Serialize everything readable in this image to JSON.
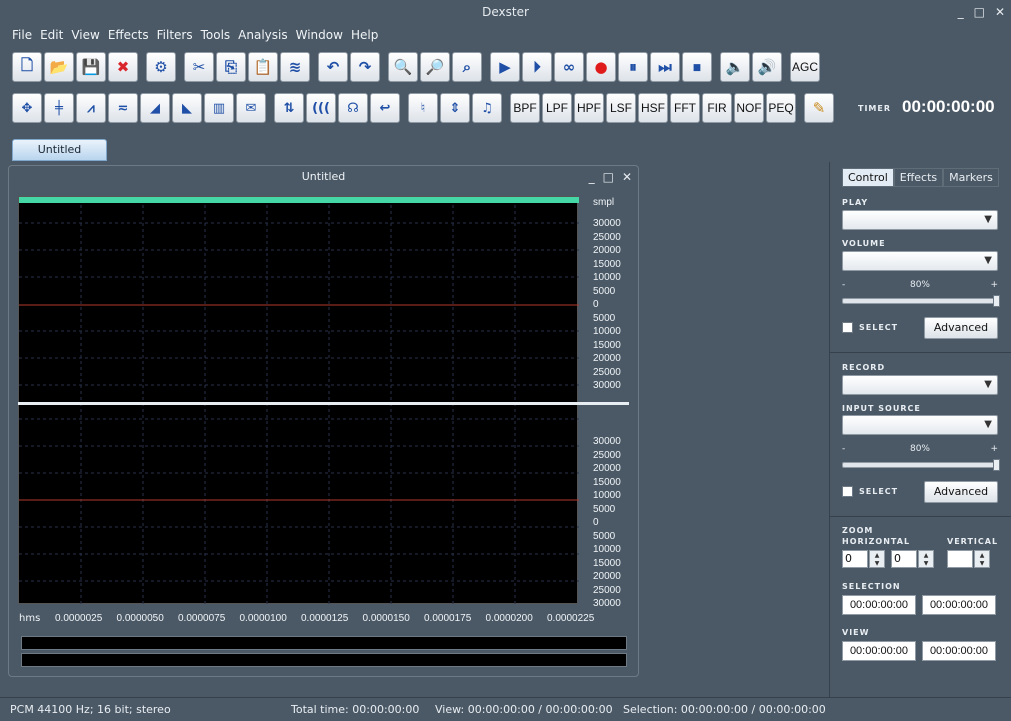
{
  "app": {
    "title": "Dexster"
  },
  "menu": [
    "File",
    "Edit",
    "View",
    "Effects",
    "Filters",
    "Tools",
    "Analysis",
    "Window",
    "Help"
  ],
  "toolbar1": [
    {
      "name": "new-icon",
      "glyph": "🗋"
    },
    {
      "name": "open-icon",
      "glyph": "📂"
    },
    {
      "name": "save-icon",
      "glyph": "💾"
    },
    {
      "name": "close-file-icon",
      "glyph": "✖"
    },
    {
      "name": "settings-icon",
      "glyph": "⚙"
    },
    {
      "name": "cut-icon",
      "glyph": "✂"
    },
    {
      "name": "copy-icon",
      "glyph": "⎘"
    },
    {
      "name": "paste-icon",
      "glyph": "📋"
    },
    {
      "name": "mix-paste-icon",
      "glyph": "≋"
    },
    {
      "name": "undo-icon",
      "glyph": "↶"
    },
    {
      "name": "redo-icon",
      "glyph": "↷"
    },
    {
      "name": "zoom-in-icon",
      "glyph": "🔍"
    },
    {
      "name": "zoom-out-icon",
      "glyph": "🔎"
    },
    {
      "name": "zoom-fit-icon",
      "glyph": "⌕"
    },
    {
      "name": "play-icon",
      "glyph": "▶"
    },
    {
      "name": "play-circle-icon",
      "glyph": "⏵"
    },
    {
      "name": "loop-icon",
      "glyph": "∞"
    },
    {
      "name": "record-icon",
      "glyph": "●"
    },
    {
      "name": "pause-icon",
      "glyph": "⏸"
    },
    {
      "name": "forward-icon",
      "glyph": "⏭"
    },
    {
      "name": "stop-icon",
      "glyph": "⏹"
    },
    {
      "name": "speaker-left-icon",
      "glyph": "🔈"
    },
    {
      "name": "speaker-right-icon",
      "glyph": "🔊"
    }
  ],
  "toolbar1_agc": "AGC",
  "toolbar2": [
    {
      "name": "expand-icon",
      "glyph": "✥"
    },
    {
      "name": "compress-icon",
      "glyph": "╪"
    },
    {
      "name": "noise-icon",
      "glyph": "⩘"
    },
    {
      "name": "silence-icon",
      "glyph": "≂"
    },
    {
      "name": "fade-in-icon",
      "glyph": "◢"
    },
    {
      "name": "fade-out-icon",
      "glyph": "◣"
    },
    {
      "name": "normalize-icon",
      "glyph": "▥"
    },
    {
      "name": "envelope-icon",
      "glyph": "✉"
    },
    {
      "name": "invert-icon",
      "glyph": "⇅"
    },
    {
      "name": "echo-icon",
      "glyph": "((("
    },
    {
      "name": "reverb-icon",
      "glyph": "☊"
    },
    {
      "name": "reverse-icon",
      "glyph": "↩"
    },
    {
      "name": "pitch-icon",
      "glyph": "♮"
    },
    {
      "name": "tempo-icon",
      "glyph": "⇕"
    },
    {
      "name": "music-note-icon",
      "glyph": "♫"
    }
  ],
  "filters": [
    "BPF",
    "LPF",
    "HPF",
    "LSF",
    "HSF",
    "FFT",
    "FIR",
    "NOF",
    "PEQ"
  ],
  "timer": {
    "label": "TIMER",
    "value": "00:00:00:00"
  },
  "document": {
    "tab": "Untitled",
    "title": "Untitled"
  },
  "waveform": {
    "unit": "smpl",
    "ticks_top": [
      "30000",
      "25000",
      "20000",
      "15000",
      "10000",
      "5000",
      "0",
      "5000",
      "10000",
      "15000",
      "20000",
      "25000",
      "30000"
    ],
    "ticks_bottom": [
      "30000",
      "25000",
      "20000",
      "15000",
      "10000",
      "5000",
      "0",
      "5000",
      "10000",
      "15000",
      "20000",
      "25000",
      "30000"
    ],
    "xunit": "hms",
    "xticks": [
      "0.0000025",
      "0.0000050",
      "0.0000075",
      "0.0000100",
      "0.0000125",
      "0.0000150",
      "0.0000175",
      "0.0000200",
      "0.0000225"
    ]
  },
  "panel": {
    "tabs": [
      "Control",
      "Effects",
      "Markers"
    ],
    "play_label": "PLAY",
    "volume_label": "VOLUME",
    "minus": "-",
    "plus": "+",
    "play_pct": "80%",
    "play_level": 0.8,
    "select_label": "SELECT",
    "advanced": "Advanced",
    "record_label": "RECORD",
    "input_source_label": "INPUT SOURCE",
    "rec_pct": "80%",
    "rec_level": 0.8,
    "zoom_label": "ZOOM",
    "horizontal_label": "HORIZONTAL",
    "vertical_label": "VERTICAL",
    "zoom_h1": "0",
    "zoom_h2": "0",
    "zoom_v": "",
    "selection_label": "SELECTION",
    "sel_start": "00:00:00:00",
    "sel_end": "00:00:00:00",
    "view_label": "VIEW",
    "view_start": "00:00:00:00",
    "view_end": "00:00:00:00"
  },
  "status": {
    "format": "PCM 44100 Hz; 16 bit; stereo",
    "total": "Total time: 00:00:00:00",
    "view": "View: 00:00:00:00 / 00:00:00:00",
    "selection": "Selection: 00:00:00:00 / 00:00:00:00"
  }
}
